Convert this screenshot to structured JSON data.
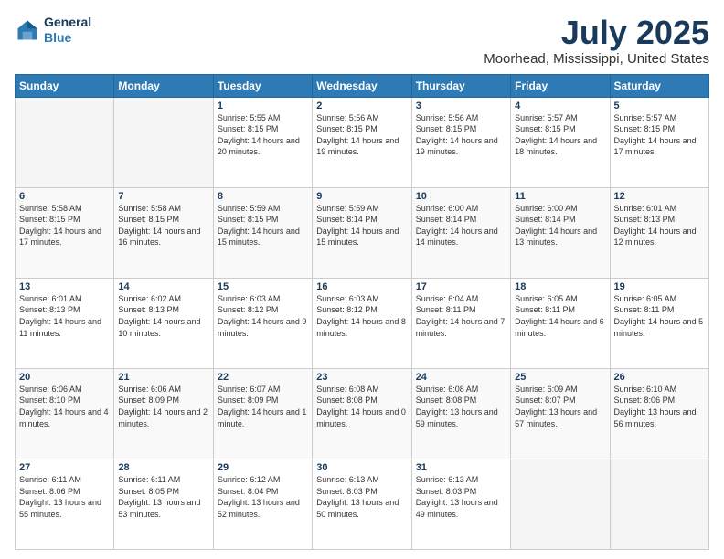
{
  "header": {
    "logo_line1": "General",
    "logo_line2": "Blue",
    "title": "July 2025",
    "subtitle": "Moorhead, Mississippi, United States"
  },
  "days_of_week": [
    "Sunday",
    "Monday",
    "Tuesday",
    "Wednesday",
    "Thursday",
    "Friday",
    "Saturday"
  ],
  "weeks": [
    [
      {
        "day": "",
        "info": ""
      },
      {
        "day": "",
        "info": ""
      },
      {
        "day": "1",
        "info": "Sunrise: 5:55 AM\nSunset: 8:15 PM\nDaylight: 14 hours and 20 minutes."
      },
      {
        "day": "2",
        "info": "Sunrise: 5:56 AM\nSunset: 8:15 PM\nDaylight: 14 hours and 19 minutes."
      },
      {
        "day": "3",
        "info": "Sunrise: 5:56 AM\nSunset: 8:15 PM\nDaylight: 14 hours and 19 minutes."
      },
      {
        "day": "4",
        "info": "Sunrise: 5:57 AM\nSunset: 8:15 PM\nDaylight: 14 hours and 18 minutes."
      },
      {
        "day": "5",
        "info": "Sunrise: 5:57 AM\nSunset: 8:15 PM\nDaylight: 14 hours and 17 minutes."
      }
    ],
    [
      {
        "day": "6",
        "info": "Sunrise: 5:58 AM\nSunset: 8:15 PM\nDaylight: 14 hours and 17 minutes."
      },
      {
        "day": "7",
        "info": "Sunrise: 5:58 AM\nSunset: 8:15 PM\nDaylight: 14 hours and 16 minutes."
      },
      {
        "day": "8",
        "info": "Sunrise: 5:59 AM\nSunset: 8:15 PM\nDaylight: 14 hours and 15 minutes."
      },
      {
        "day": "9",
        "info": "Sunrise: 5:59 AM\nSunset: 8:14 PM\nDaylight: 14 hours and 15 minutes."
      },
      {
        "day": "10",
        "info": "Sunrise: 6:00 AM\nSunset: 8:14 PM\nDaylight: 14 hours and 14 minutes."
      },
      {
        "day": "11",
        "info": "Sunrise: 6:00 AM\nSunset: 8:14 PM\nDaylight: 14 hours and 13 minutes."
      },
      {
        "day": "12",
        "info": "Sunrise: 6:01 AM\nSunset: 8:13 PM\nDaylight: 14 hours and 12 minutes."
      }
    ],
    [
      {
        "day": "13",
        "info": "Sunrise: 6:01 AM\nSunset: 8:13 PM\nDaylight: 14 hours and 11 minutes."
      },
      {
        "day": "14",
        "info": "Sunrise: 6:02 AM\nSunset: 8:13 PM\nDaylight: 14 hours and 10 minutes."
      },
      {
        "day": "15",
        "info": "Sunrise: 6:03 AM\nSunset: 8:12 PM\nDaylight: 14 hours and 9 minutes."
      },
      {
        "day": "16",
        "info": "Sunrise: 6:03 AM\nSunset: 8:12 PM\nDaylight: 14 hours and 8 minutes."
      },
      {
        "day": "17",
        "info": "Sunrise: 6:04 AM\nSunset: 8:11 PM\nDaylight: 14 hours and 7 minutes."
      },
      {
        "day": "18",
        "info": "Sunrise: 6:05 AM\nSunset: 8:11 PM\nDaylight: 14 hours and 6 minutes."
      },
      {
        "day": "19",
        "info": "Sunrise: 6:05 AM\nSunset: 8:11 PM\nDaylight: 14 hours and 5 minutes."
      }
    ],
    [
      {
        "day": "20",
        "info": "Sunrise: 6:06 AM\nSunset: 8:10 PM\nDaylight: 14 hours and 4 minutes."
      },
      {
        "day": "21",
        "info": "Sunrise: 6:06 AM\nSunset: 8:09 PM\nDaylight: 14 hours and 2 minutes."
      },
      {
        "day": "22",
        "info": "Sunrise: 6:07 AM\nSunset: 8:09 PM\nDaylight: 14 hours and 1 minute."
      },
      {
        "day": "23",
        "info": "Sunrise: 6:08 AM\nSunset: 8:08 PM\nDaylight: 14 hours and 0 minutes."
      },
      {
        "day": "24",
        "info": "Sunrise: 6:08 AM\nSunset: 8:08 PM\nDaylight: 13 hours and 59 minutes."
      },
      {
        "day": "25",
        "info": "Sunrise: 6:09 AM\nSunset: 8:07 PM\nDaylight: 13 hours and 57 minutes."
      },
      {
        "day": "26",
        "info": "Sunrise: 6:10 AM\nSunset: 8:06 PM\nDaylight: 13 hours and 56 minutes."
      }
    ],
    [
      {
        "day": "27",
        "info": "Sunrise: 6:11 AM\nSunset: 8:06 PM\nDaylight: 13 hours and 55 minutes."
      },
      {
        "day": "28",
        "info": "Sunrise: 6:11 AM\nSunset: 8:05 PM\nDaylight: 13 hours and 53 minutes."
      },
      {
        "day": "29",
        "info": "Sunrise: 6:12 AM\nSunset: 8:04 PM\nDaylight: 13 hours and 52 minutes."
      },
      {
        "day": "30",
        "info": "Sunrise: 6:13 AM\nSunset: 8:03 PM\nDaylight: 13 hours and 50 minutes."
      },
      {
        "day": "31",
        "info": "Sunrise: 6:13 AM\nSunset: 8:03 PM\nDaylight: 13 hours and 49 minutes."
      },
      {
        "day": "",
        "info": ""
      },
      {
        "day": "",
        "info": ""
      }
    ]
  ]
}
